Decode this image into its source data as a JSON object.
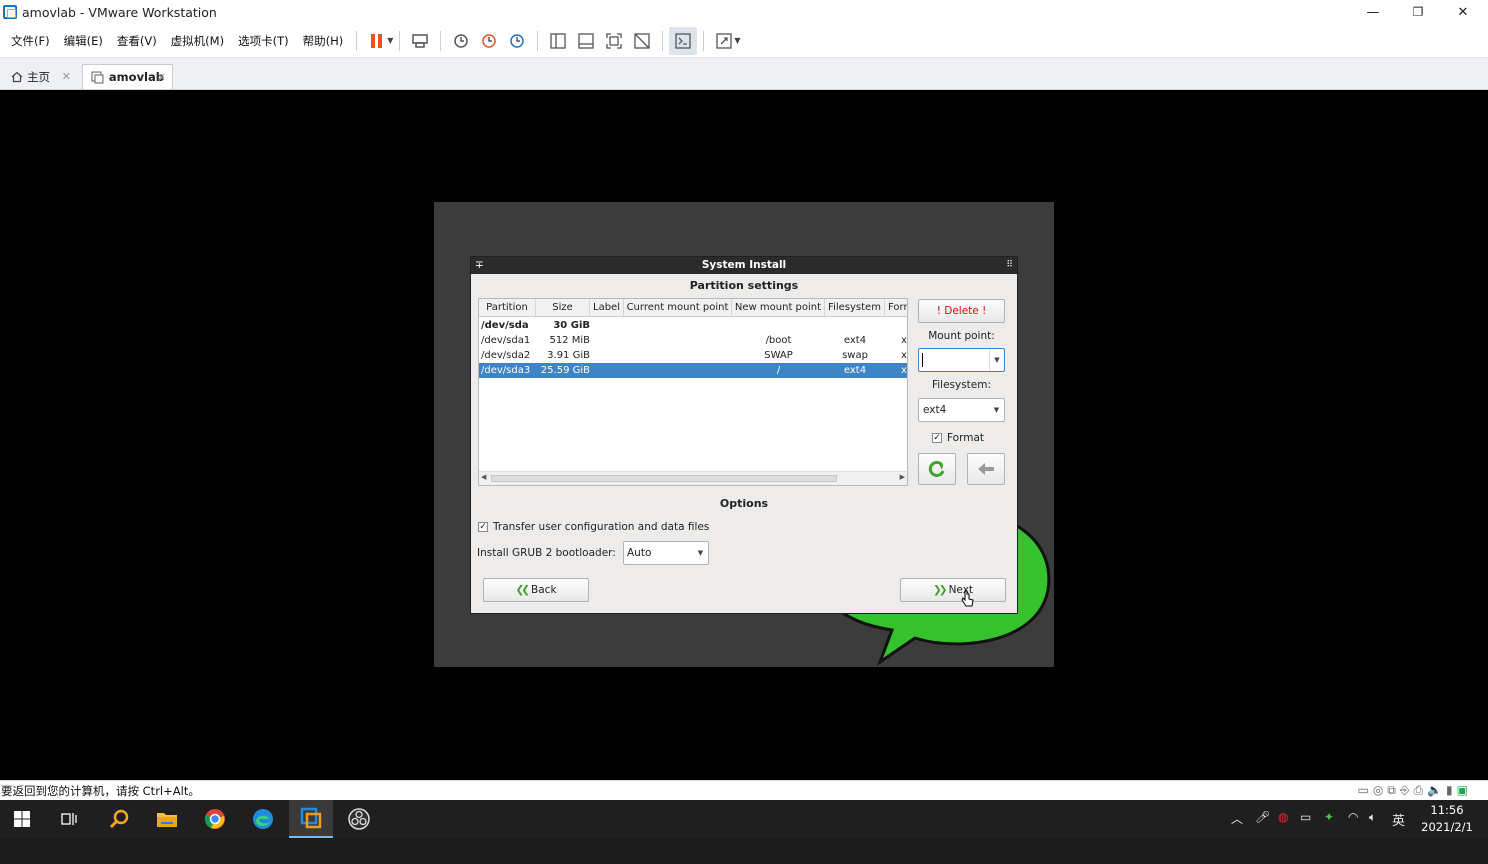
{
  "window": {
    "title": "amovlab - VMware Workstation",
    "minimize": "—",
    "restore": "❐",
    "close": "✕"
  },
  "menu": [
    "文件(F)",
    "编辑(E)",
    "查看(V)",
    "虚拟机(M)",
    "选项卡(T)",
    "帮助(H)"
  ],
  "tabs": {
    "home": "主页",
    "vm": "amovlab"
  },
  "installer": {
    "window_title": "System Install",
    "partition_title": "Partition settings",
    "columns": [
      "Partition",
      "Size",
      "Label",
      "Current mount point",
      "New mount point",
      "Filesystem",
      "Format"
    ],
    "rows": [
      {
        "partition": "/dev/sda",
        "size": "30 GiB",
        "label": "",
        "current": "",
        "new_mount": "",
        "fs": "",
        "format": "",
        "bold": true
      },
      {
        "partition": "/dev/sda1",
        "size": "512 MiB",
        "label": "",
        "current": "",
        "new_mount": "/boot",
        "fs": "ext4",
        "format": "x"
      },
      {
        "partition": "/dev/sda2",
        "size": "3.91 GiB",
        "label": "",
        "current": "",
        "new_mount": "SWAP",
        "fs": "swap",
        "format": "x"
      },
      {
        "partition": "/dev/sda3",
        "size": "25.59 GiB",
        "label": "",
        "current": "",
        "new_mount": "/",
        "fs": "ext4",
        "format": "x",
        "selected": true
      }
    ],
    "delete_label": "! Delete !",
    "mount_point_label": "Mount point:",
    "mount_point_value": "",
    "filesystem_label": "Filesystem:",
    "filesystem_value": "ext4",
    "format_label": "Format",
    "format_checked": true,
    "options_title": "Options",
    "transfer_label": "Transfer user configuration and data files",
    "transfer_checked": true,
    "grub_label": "Install GRUB 2 bootloader:",
    "grub_value": "Auto",
    "back_label": "Back",
    "next_label": "Next"
  },
  "statusbar": {
    "message": "要返回到您的计算机，请按 Ctrl+Alt。"
  },
  "taskbar": {
    "ime": "英",
    "time": "11:56",
    "date": "2021/2/1"
  },
  "colors": {
    "selection": "#3d85c6",
    "accent_green": "#3fa22b",
    "delete_red": "#d01010"
  }
}
